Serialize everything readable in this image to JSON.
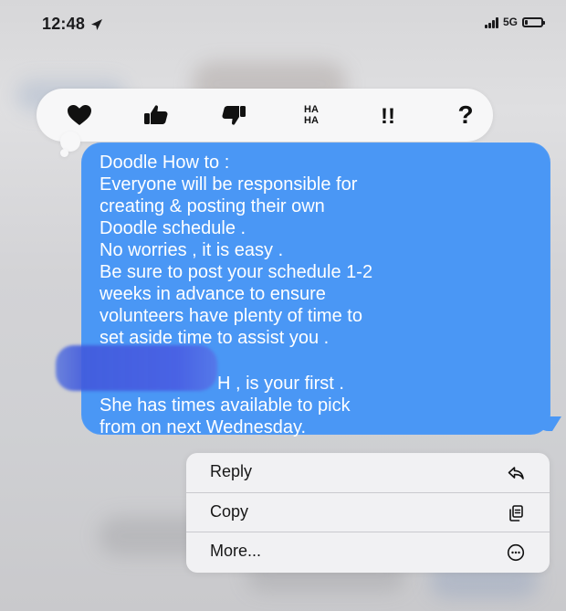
{
  "status_bar": {
    "time": "12:48",
    "network": "5G",
    "battery_level": 0.2,
    "icons": [
      "location-icon",
      "signal-icon",
      "battery-icon"
    ]
  },
  "reactions": [
    {
      "name": "heart-icon"
    },
    {
      "name": "thumbs-up-icon"
    },
    {
      "name": "thumbs-down-icon"
    },
    {
      "name": "haha-icon",
      "label_top": "HA",
      "label_bottom": "HA"
    },
    {
      "name": "double-exclamation-icon",
      "label": "!!"
    },
    {
      "name": "question-icon",
      "label": "?"
    }
  ],
  "message": {
    "lines": [
      "Doodle How to :",
      "Everyone will be responsible for",
      "creating & posting their own",
      "Doodle schedule .",
      "No worries , it is easy .",
      "Be sure to post your schedule 1-2",
      "weeks in advance to ensure",
      "volunteers have plenty of time to",
      "set aside time to assist you .",
      "H , is your first .",
      "She has times available to pick",
      "from on next Wednesday."
    ]
  },
  "menu": {
    "items": [
      {
        "label": "Reply",
        "icon": "reply-icon"
      },
      {
        "label": "Copy",
        "icon": "copy-icon"
      },
      {
        "label": "More...",
        "icon": "more-icon"
      }
    ]
  },
  "colors": {
    "background": "#d7d7d9",
    "reaction_bar": "#f7f7f8",
    "message_bubble": "#4a97f5",
    "menu_background": "#f1f1f3",
    "menu_text": "#171717",
    "redaction": "#4760df"
  }
}
